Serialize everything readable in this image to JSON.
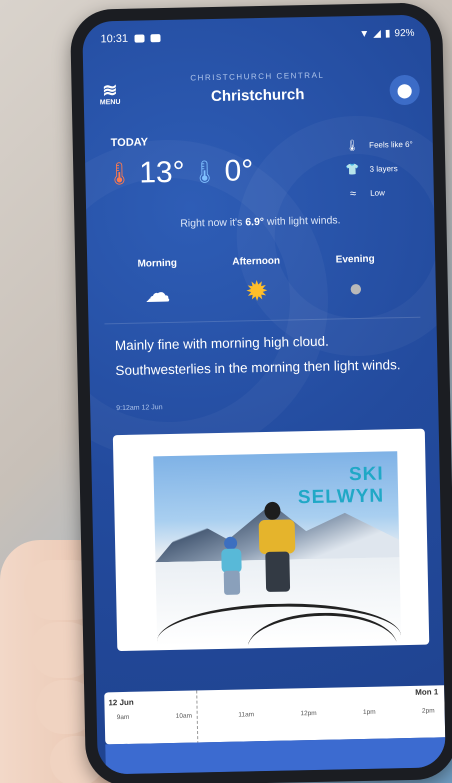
{
  "status": {
    "time": "10:31",
    "battery": "92%"
  },
  "header": {
    "region": "CHRISTCHURCH CENTRAL",
    "city": "Christchurch",
    "menu_label": "MENU"
  },
  "today": {
    "label": "TODAY",
    "high": "13°",
    "low": "0°",
    "feels_like": "Feels like 6°",
    "layers": "3 layers",
    "wind": "Low",
    "now_prefix": "Right now it's ",
    "now_temp": "6.9°",
    "now_suffix": " with light winds."
  },
  "periods": [
    {
      "label": "Morning",
      "icon": "partly-cloudy-icon"
    },
    {
      "label": "Afternoon",
      "icon": "sun-icon"
    },
    {
      "label": "Evening",
      "icon": "moon-icon"
    }
  ],
  "forecast": {
    "text": "Mainly fine with morning high cloud. Southwesterlies in the morning then light winds.",
    "issued": "9:12am 12 Jun"
  },
  "ad": {
    "logo_line1": "SKI",
    "logo_line2": "SELWYN"
  },
  "timeline": {
    "start_date": "12 Jun",
    "end_date": "Mon 1",
    "hours": [
      "9am",
      "10am",
      "11am",
      "12pm",
      "1pm",
      "2pm"
    ]
  },
  "colors": {
    "background": "#234b9e",
    "accent": "#3c6cc7"
  }
}
